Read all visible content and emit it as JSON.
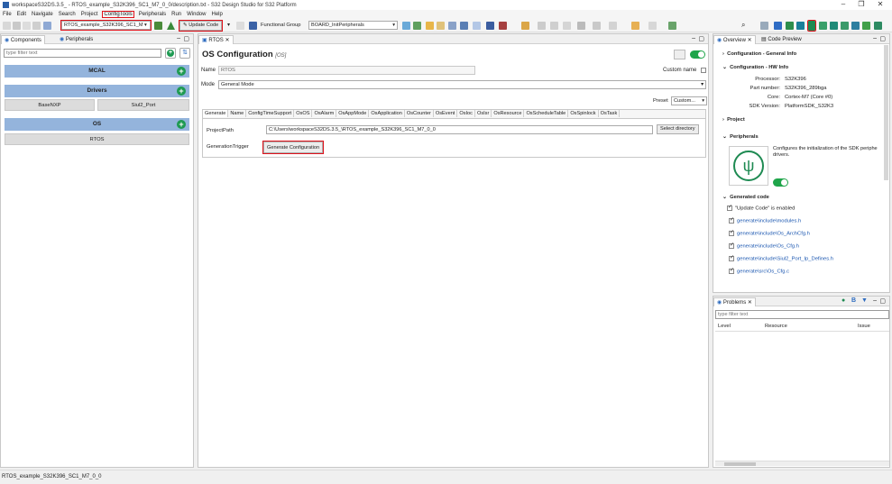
{
  "window": {
    "title": "workspaceS32DS.3.5_                    - RTOS_example_S32K396_SC1_M7_0_0/description.txt - S32 Design Studio for S32 Platform",
    "controls": [
      "–",
      "❐",
      "✕"
    ]
  },
  "menu": [
    "File",
    "Edit",
    "Navigate",
    "Search",
    "Project",
    "ConfigTools",
    "Peripherals",
    "Run",
    "Window",
    "Help"
  ],
  "toolbar": {
    "project_combo": "RTOS_example_S32K396_SC1_M",
    "update_code_label": "Update Code",
    "functional_group_label": "Functional Group",
    "functional_group_value": "BOARD_InitPeripherals"
  },
  "left_panel": {
    "tabs": [
      "Components",
      "Peripherals"
    ],
    "filter_placeholder": "type filter text",
    "sections": [
      {
        "name": "MCAL",
        "items": []
      },
      {
        "name": "Drivers",
        "items": [
          "BaseNXP",
          "Siul2_Port"
        ]
      },
      {
        "name": "OS",
        "items": [
          "RTOS"
        ]
      }
    ]
  },
  "editor": {
    "tab": "RTOS",
    "heading": "OS Configuration",
    "heading_sub": "[OS]",
    "name_label": "Name",
    "name_value": "RTOS",
    "custom_name_label": "Custom name",
    "mode_label": "Mode",
    "mode_value": "General Mode",
    "preset_label": "Preset",
    "preset_value": "Custom...",
    "config_tabs": [
      "Generate",
      "Name",
      "ConfigTimeSupport",
      "OsOS",
      "OsAlarm",
      "OsAppMode",
      "OsApplication",
      "OsCounter",
      "OsEvent",
      "OsIoc",
      "OsIsr",
      "OsResource",
      "OsScheduleTable",
      "OsSpinlock",
      "OsTask"
    ],
    "project_path_label": "ProjectPath",
    "project_path_value": "C:\\Users\\workspaceS32DS.3.5_\\RTOS_example_S32K396_SC1_M7_0_0",
    "select_dir_label": "Select directory",
    "generation_trigger_label": "GenerationTrigger",
    "generate_config_label": "Generate Configuration"
  },
  "overview": {
    "tabs": [
      "Overview",
      "Code Preview"
    ],
    "config_general": "Configuration - General Info",
    "config_hw": "Configuration - HW Info",
    "hw_rows": [
      {
        "k": "Processor:",
        "v": "S32K396"
      },
      {
        "k": "Part number:",
        "v": "S32K396_289bga"
      },
      {
        "k": "Core:",
        "v": "Cortex-M7 (Core #0)"
      },
      {
        "k": "SDK Version:",
        "v": "PlatformSDK_S32K3"
      }
    ],
    "project_label": "Project",
    "peripherals_label": "Peripherals",
    "peripherals_desc": "Configures the initialization of the SDK periphe drivers.",
    "generated_code_label": "Generated code",
    "update_code_enabled": "\"Update Code\" is enabled",
    "files": [
      "generate\\include\\modules.h",
      "generate\\include\\Os_ArchCfg.h",
      "generate\\include\\Os_Cfg.h",
      "generate\\include\\Siul2_Port_Ip_Defines.h",
      "generate\\src\\Os_Cfg.c"
    ]
  },
  "problems": {
    "tab": "Problems",
    "filter_placeholder": "type filter text",
    "columns": [
      "Level",
      "Resource",
      "Issue"
    ]
  },
  "status_bar": "RTOS_example_S32K396_SC1_M7_0_0",
  "colors": {
    "accent": "#e0121b",
    "section": "#94b4dc",
    "green": "#1e9a52",
    "link": "#1a56b0"
  }
}
